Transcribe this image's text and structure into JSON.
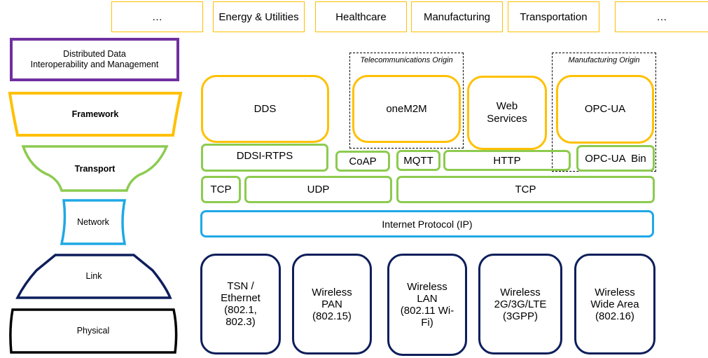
{
  "industries": [
    "…",
    "Energy & Utilities",
    "Healthcare",
    "Manufacturing",
    "Transportation",
    "…"
  ],
  "layers": {
    "data": "Distributed Data\nInteroperability and Management",
    "framework": "Framework",
    "transport": "Transport",
    "network": "Network",
    "link": "Link",
    "physical": "Physical"
  },
  "origins": {
    "telecom": "Telecommunications Origin",
    "manufacturing": "Manufacturing Origin"
  },
  "frameworks": {
    "dds": "DDS",
    "onem2m": "oneM2M",
    "web_services": "Web\nServices",
    "opcua": "OPC-UA"
  },
  "protocols": {
    "ddsi_rtps": "DDSI-RTPS",
    "coap": "CoAP",
    "mqtt": "MQTT",
    "http": "HTTP",
    "opcua_bin": "OPC-UA  Bin"
  },
  "transport": {
    "tcp_left": "TCP",
    "udp": "UDP",
    "tcp_right": "TCP"
  },
  "network": {
    "ip": "Internet Protocol (IP)"
  },
  "links": [
    "TSN /\nEthernet\n(802.1,\n802.3)",
    "Wireless\nPAN\n(802.15)",
    "Wireless\nLAN\n(802.11 Wi-\nFi)",
    "Wireless\n2G/3G/LTE\n(3GPP)",
    "Wireless\nWide Area\n(802.16)"
  ],
  "colors": {
    "data": "#7030A0",
    "framework": "#FFC000",
    "transport": "#8CCB4F",
    "network": "#1FA8E6",
    "link": "#0D1E5B",
    "physical": "#000000"
  }
}
